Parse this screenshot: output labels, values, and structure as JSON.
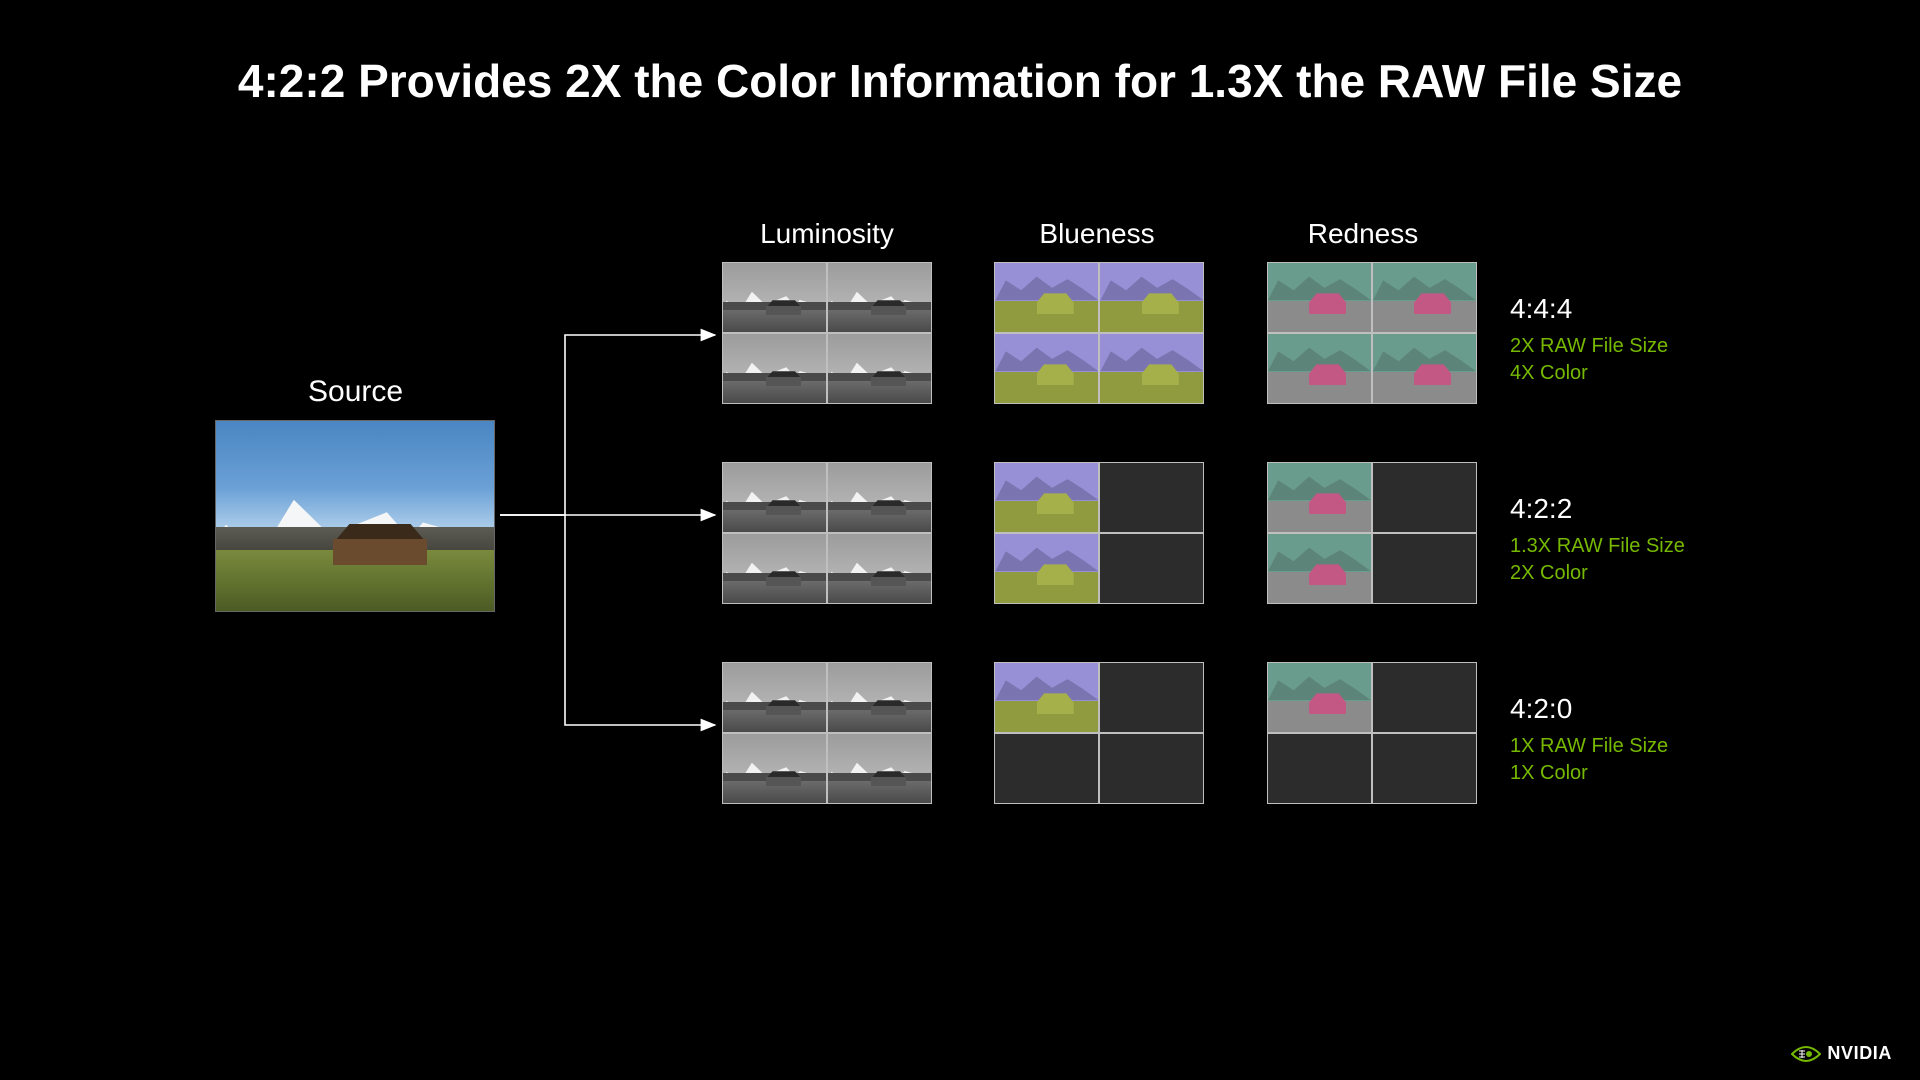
{
  "title": "4:2:2 Provides 2X the Color Information for 1.3X the RAW File Size",
  "source_label": "Source",
  "columns": {
    "luminosity": "Luminosity",
    "blueness": "Blueness",
    "redness": "Redness"
  },
  "rows": [
    {
      "format": "4:4:4",
      "file_size": "2X RAW File Size",
      "color": "4X Color",
      "luminosity_quads": [
        true,
        true,
        true,
        true
      ],
      "blueness_quads": [
        true,
        true,
        true,
        true
      ],
      "redness_quads": [
        true,
        true,
        true,
        true
      ]
    },
    {
      "format": "4:2:2",
      "file_size": "1.3X RAW File Size",
      "color": "2X Color",
      "luminosity_quads": [
        true,
        true,
        true,
        true
      ],
      "blueness_quads": [
        true,
        false,
        true,
        false
      ],
      "redness_quads": [
        true,
        false,
        true,
        false
      ]
    },
    {
      "format": "4:2:0",
      "file_size": "1X RAW File Size",
      "color": "1X Color",
      "luminosity_quads": [
        true,
        true,
        true,
        true
      ],
      "blueness_quads": [
        true,
        false,
        false,
        false
      ],
      "redness_quads": [
        true,
        false,
        false,
        false
      ]
    }
  ],
  "brand": "NVIDIA",
  "colors": {
    "accent": "#76b900"
  }
}
